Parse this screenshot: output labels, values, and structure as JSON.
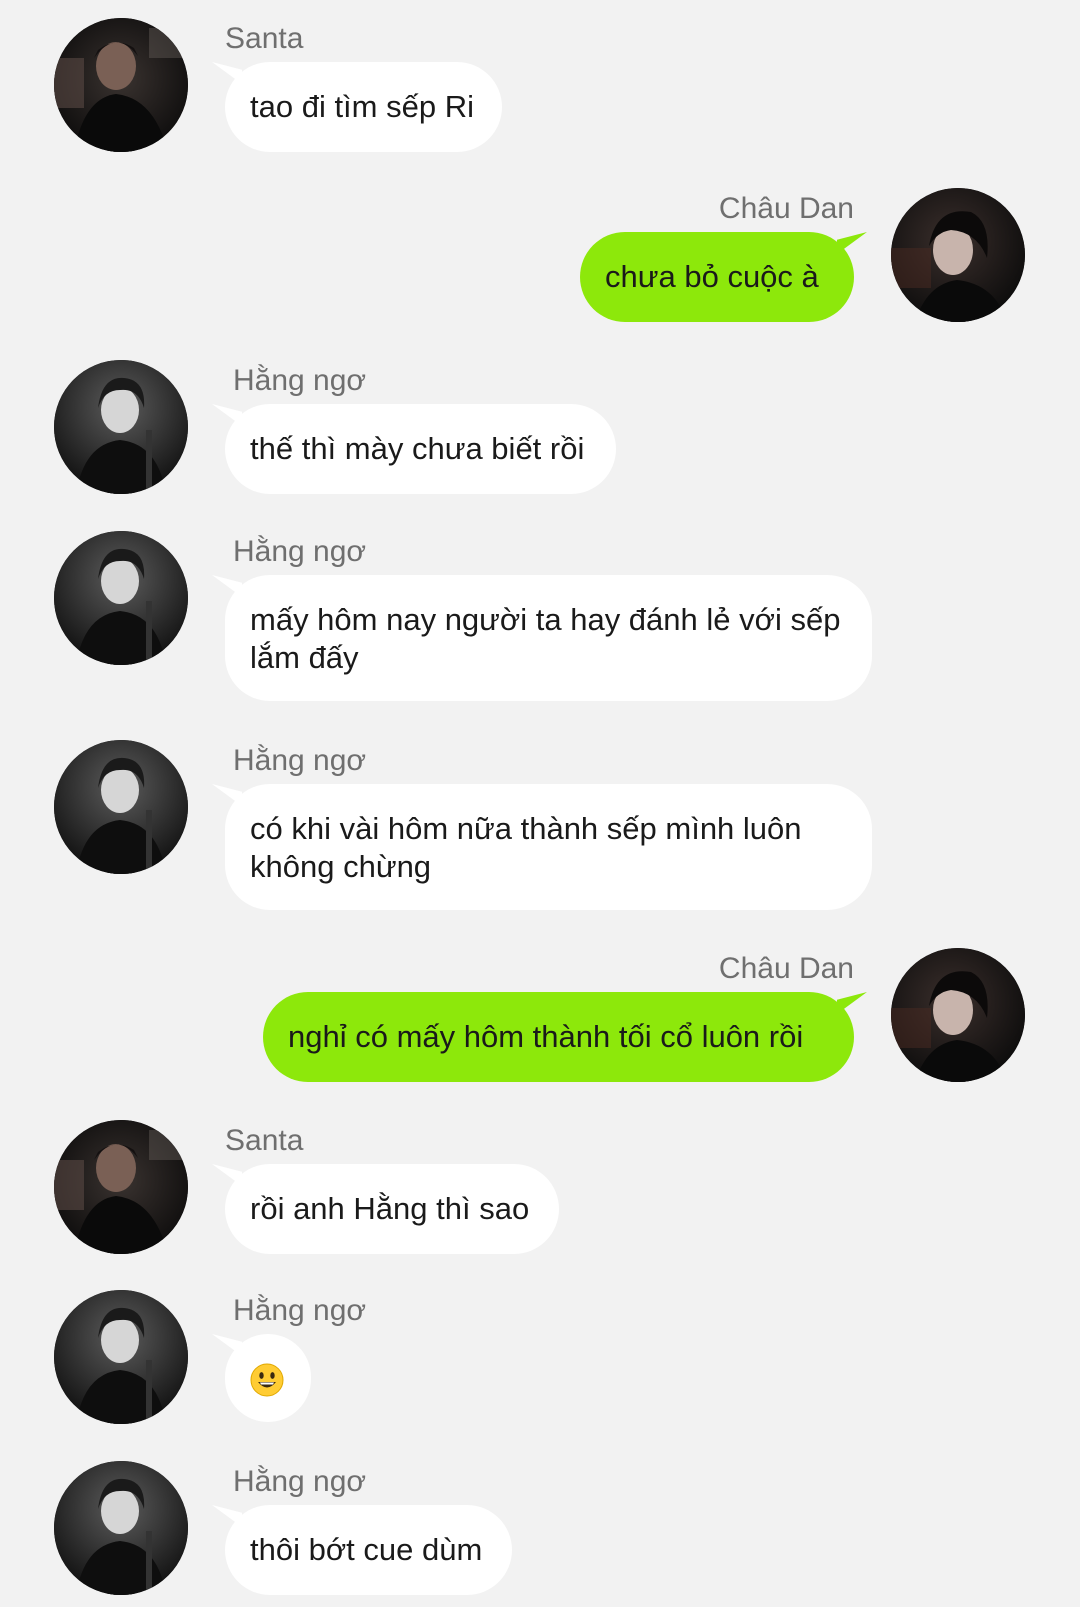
{
  "colors": {
    "background": "#f2f2f2",
    "incoming_bubble": "#ffffff",
    "outgoing_bubble": "#8de80b",
    "sender_name": "#6f6f6f",
    "text": "#1a1a1a"
  },
  "messages": [
    {
      "sender": "Santa",
      "side": "left",
      "avatar": "santa-avatar",
      "text": "tao đi tìm sếp Ri"
    },
    {
      "sender": "Châu Dan",
      "side": "right",
      "avatar": "chau-dan-avatar",
      "text": "chưa bỏ cuộc à"
    },
    {
      "sender": "Hằng ngơ",
      "side": "left",
      "avatar": "hang-ngo-avatar",
      "text": "thế thì mày chưa biết rồi"
    },
    {
      "sender": "Hằng ngơ",
      "side": "left",
      "avatar": "hang-ngo-avatar",
      "text": "mấy hôm nay người ta hay đánh lẻ với sếp lắm đấy"
    },
    {
      "sender": "Hằng ngơ",
      "side": "left",
      "avatar": "hang-ngo-avatar",
      "text": "có khi vài hôm nữa thành sếp mình luôn không chừng"
    },
    {
      "sender": "Châu Dan",
      "side": "right",
      "avatar": "chau-dan-avatar",
      "text": "nghỉ có mấy hôm thành tối cổ luôn rồi"
    },
    {
      "sender": "Santa",
      "side": "left",
      "avatar": "santa-avatar",
      "text": "rồi anh Hằng thì sao"
    },
    {
      "sender": "Hằng ngơ",
      "side": "left",
      "avatar": "hang-ngo-avatar",
      "text": "",
      "emoji": "smiley-emoji-icon"
    },
    {
      "sender": "Hằng ngơ",
      "side": "left",
      "avatar": "hang-ngo-avatar",
      "text": "thôi bớt cue dùm"
    }
  ]
}
